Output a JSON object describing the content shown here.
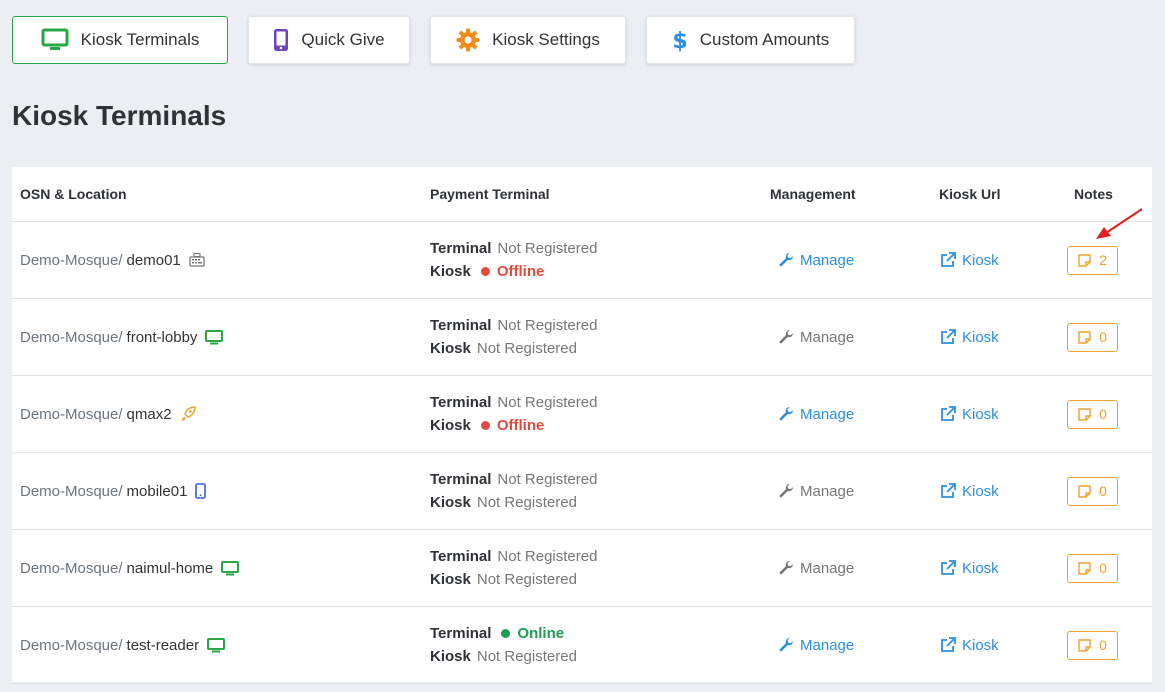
{
  "tabs": [
    {
      "label": "Kiosk Terminals",
      "icon": "monitor-icon",
      "color": "#28a745",
      "active": true
    },
    {
      "label": "Quick Give",
      "icon": "mobile-icon",
      "color": "#6f42c1",
      "active": false
    },
    {
      "label": "Kiosk Settings",
      "icon": "gear-icon",
      "color": "#f08c1a",
      "active": false
    },
    {
      "label": "Custom Amounts",
      "icon": "dollar-icon",
      "color": "#2b8fe0",
      "active": false
    }
  ],
  "page_title": "Kiosk Terminals",
  "table": {
    "headers": {
      "osn": "OSN & Location",
      "payment": "Payment Terminal",
      "management": "Management",
      "kiosk_url": "Kiosk Url",
      "notes": "Notes"
    },
    "rows": [
      {
        "prefix": "Demo-Mosque/",
        "name": "demo01",
        "device_icon": "keyboard-icon",
        "terminal_label": "Terminal",
        "terminal_status": "Not Registered",
        "kiosk_label": "Kiosk",
        "kiosk_status": "Offline",
        "manage": "Manage",
        "manage_active": true,
        "kiosk_link": "Kiosk",
        "notes": "2"
      },
      {
        "prefix": "Demo-Mosque/",
        "name": "front-lobby",
        "device_icon": "monitor-icon",
        "terminal_label": "Terminal",
        "terminal_status": "Not Registered",
        "kiosk_label": "Kiosk",
        "kiosk_status": "Not Registered",
        "manage": "Manage",
        "manage_active": false,
        "kiosk_link": "Kiosk",
        "notes": "0"
      },
      {
        "prefix": "Demo-Mosque/",
        "name": "qmax2",
        "device_icon": "rocket-icon",
        "terminal_label": "Terminal",
        "terminal_status": "Not Registered",
        "kiosk_label": "Kiosk",
        "kiosk_status": "Offline",
        "manage": "Manage",
        "manage_active": true,
        "kiosk_link": "Kiosk",
        "notes": "0"
      },
      {
        "prefix": "Demo-Mosque/",
        "name": "mobile01",
        "device_icon": "mobile-icon",
        "terminal_label": "Terminal",
        "terminal_status": "Not Registered",
        "kiosk_label": "Kiosk",
        "kiosk_status": "Not Registered",
        "manage": "Manage",
        "manage_active": false,
        "kiosk_link": "Kiosk",
        "notes": "0"
      },
      {
        "prefix": "Demo-Mosque/",
        "name": "naimul-home",
        "device_icon": "monitor-icon",
        "terminal_label": "Terminal",
        "terminal_status": "Not Registered",
        "kiosk_label": "Kiosk",
        "kiosk_status": "Not Registered",
        "manage": "Manage",
        "manage_active": false,
        "kiosk_link": "Kiosk",
        "notes": "0"
      },
      {
        "prefix": "Demo-Mosque/",
        "name": "test-reader",
        "device_icon": "monitor-icon",
        "terminal_label": "Terminal",
        "terminal_status": "Online",
        "kiosk_label": "Kiosk",
        "kiosk_status": "Not Registered",
        "manage": "Manage",
        "manage_active": true,
        "kiosk_link": "Kiosk",
        "notes": "0"
      }
    ]
  },
  "colors": {
    "offline": "#e04b3e",
    "online": "#1f9d55",
    "link": "#2b8fe0",
    "notes": "#f0a12d",
    "annotation_arrow": "#e02020"
  }
}
